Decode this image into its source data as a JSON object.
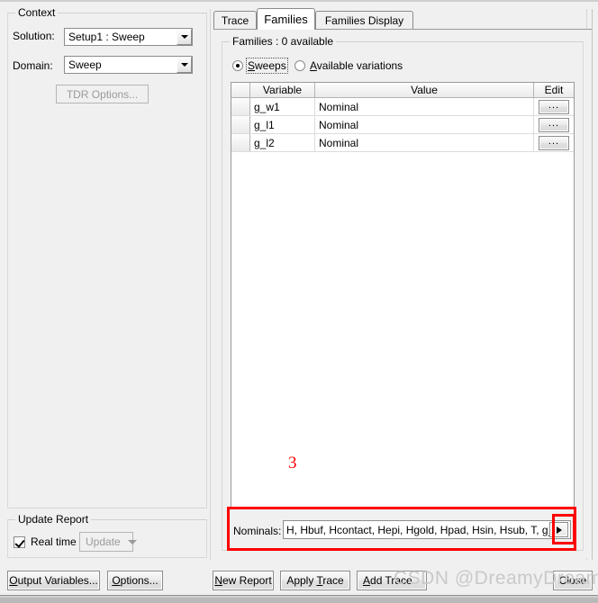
{
  "dialog": {
    "background_color": "#f0f0f0",
    "accent_color": "#fe0000"
  },
  "context_group": {
    "title": "Context",
    "solution_label": "Solution:",
    "solution_value": "Setup1 : Sweep",
    "domain_label": "Domain:",
    "domain_value": "Sweep",
    "tdr_options_button": "TDR Options..."
  },
  "update_report_group": {
    "title": "Update Report",
    "real_time_label": "Real time",
    "real_time_checked": true,
    "update_button": "Update",
    "update_disabled": true
  },
  "left_buttons": {
    "output_variables": "Output Variables...",
    "options": "Options..."
  },
  "tabs": [
    {
      "label": "Trace",
      "selected": false
    },
    {
      "label": "Families",
      "selected": true
    },
    {
      "label": "Families Display",
      "selected": false
    }
  ],
  "families_group": {
    "title": "Families : 0 available",
    "radio_sweeps": "Sweeps",
    "radio_sweeps_mnemonic": "S",
    "radio_available": "Available variations",
    "radio_available_mnemonic": "A",
    "selected_radio": "Sweeps"
  },
  "grid": {
    "headers": [
      "",
      "Variable",
      "Value",
      "Edit"
    ],
    "rows": [
      {
        "variable": "g_w1",
        "value": "Nominal",
        "edit": "..."
      },
      {
        "variable": "g_l1",
        "value": "Nominal",
        "edit": "..."
      },
      {
        "variable": "g_l2",
        "value": "Nominal",
        "edit": "..."
      }
    ]
  },
  "nominals": {
    "label": "Nominals:",
    "value": "H, Hbuf, Hcontact, Hepi, Hgold, Hpad, Hsin, Hsub, T, g_ang, g_",
    "dropdown_icon": "arrow-right-icon"
  },
  "bottom_buttons": {
    "new_report": "New Report",
    "apply_trace": "Apply Trace",
    "add_trace": "Add Trace",
    "close": "Close"
  },
  "annotations": {
    "step_number": "3",
    "highlight_color": "#fe0000"
  },
  "watermark": {
    "text": "CSDN @DreamyDreamer"
  }
}
